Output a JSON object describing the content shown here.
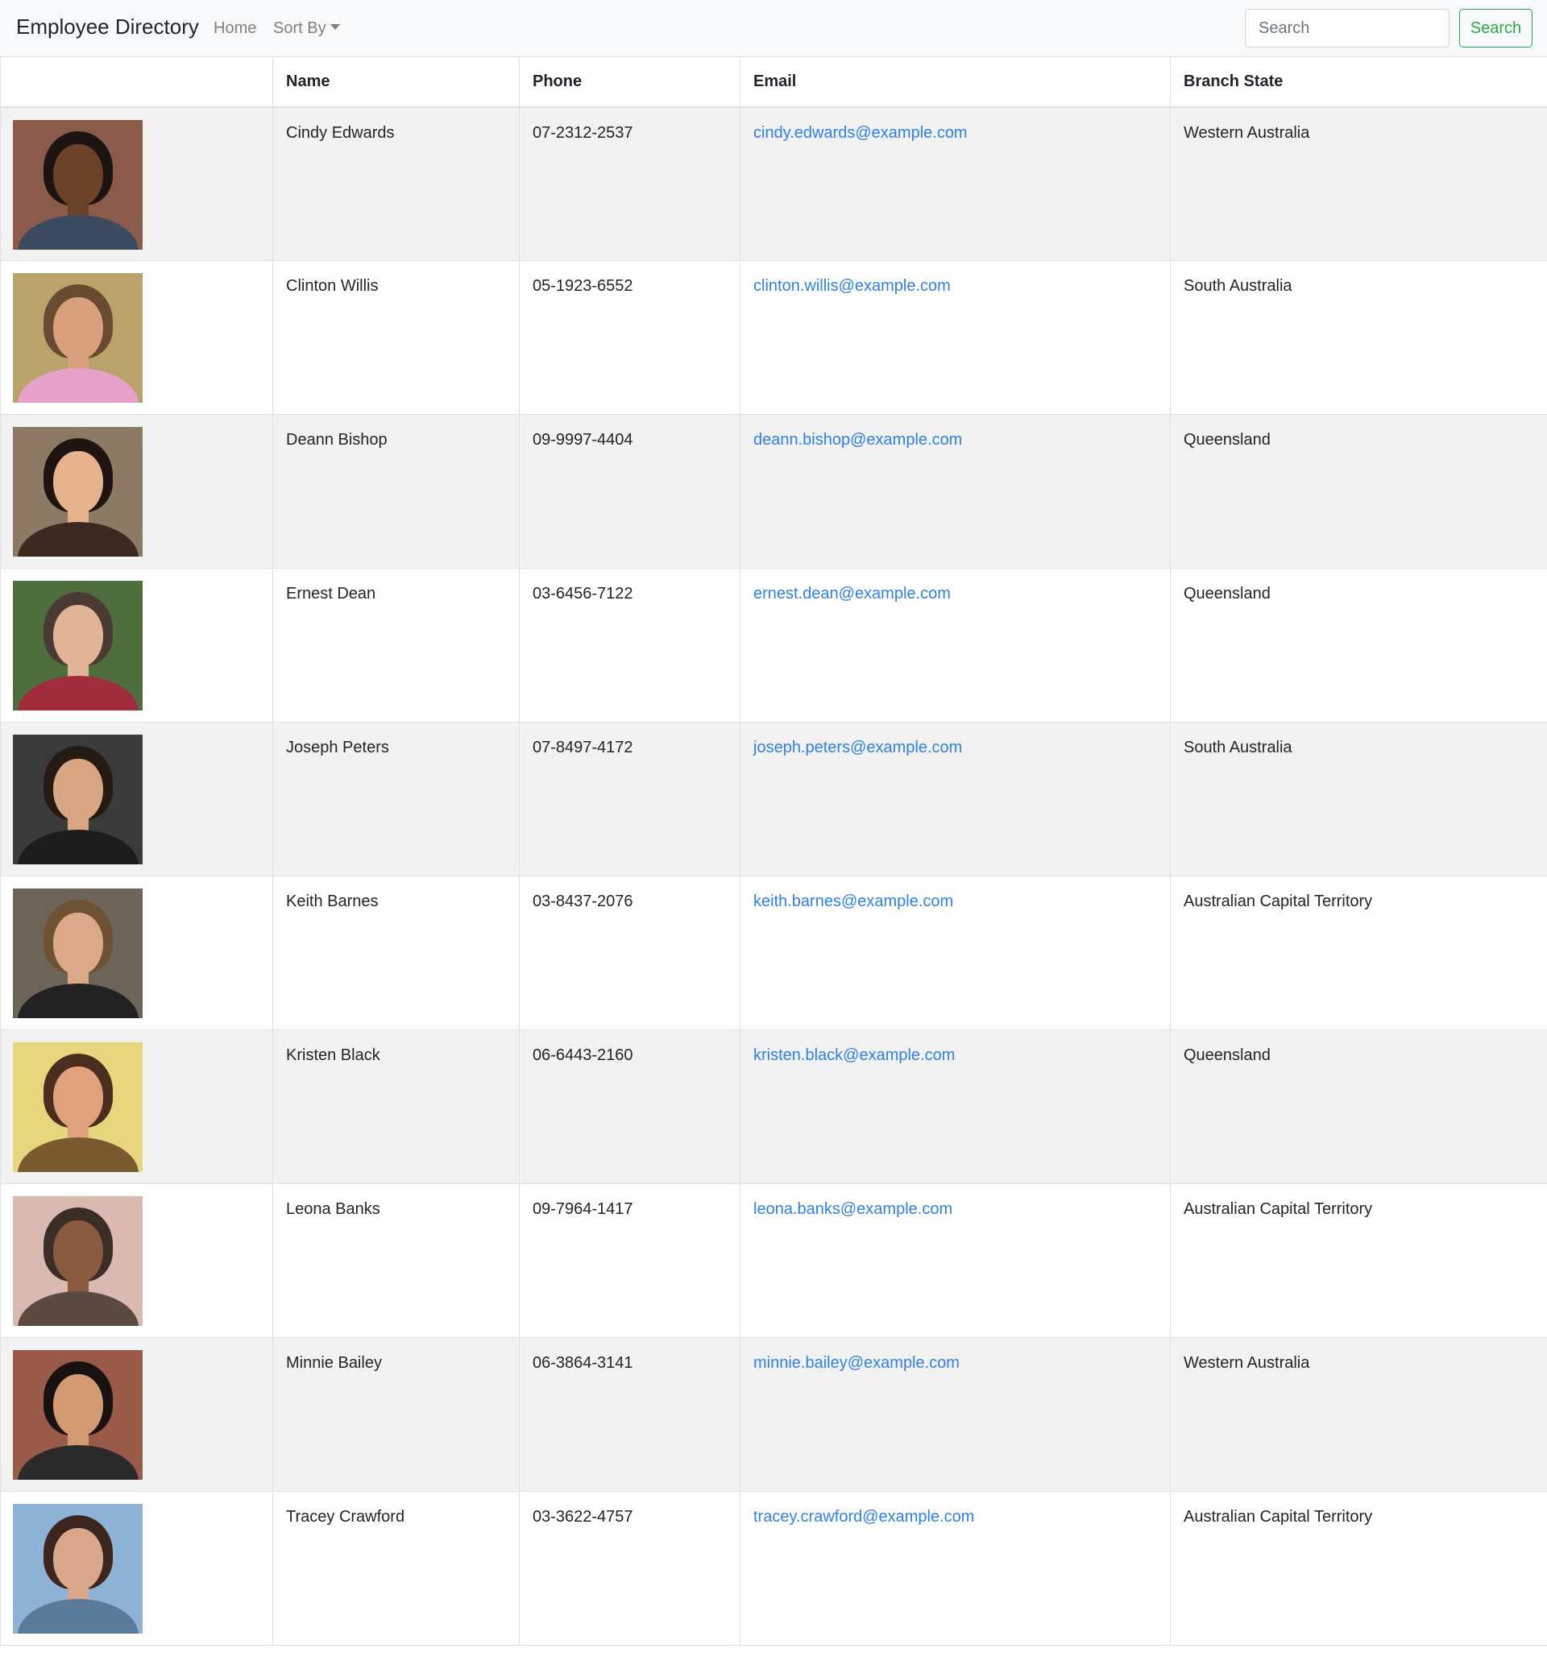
{
  "navbar": {
    "brand": "Employee Directory",
    "home_label": "Home",
    "sort_label": "Sort By",
    "search_placeholder": "Search",
    "search_button_label": "Search",
    "accent_color": "#28a745"
  },
  "table": {
    "headers": {
      "image": "",
      "name": "Name",
      "phone": "Phone",
      "email": "Email",
      "state": "Branch State"
    },
    "link_color": "#2f80ed",
    "rows": [
      {
        "name": "Cindy Edwards",
        "phone": "07-2312-2537",
        "email": "cindy.edwards@example.com",
        "state": "Western Australia",
        "avatar": {
          "bg": "#8a5a4a",
          "hair": "#1c1410",
          "skin": "#6b4228",
          "shirt": "#3b4a5e"
        }
      },
      {
        "name": "Clinton Willis",
        "phone": "05-1923-6552",
        "email": "clinton.willis@example.com",
        "state": "South Australia",
        "avatar": {
          "bg": "#b9a36a",
          "hair": "#6b4a32",
          "skin": "#d9a07e",
          "shirt": "#e6a2c8"
        }
      },
      {
        "name": "Deann Bishop",
        "phone": "09-9997-4404",
        "email": "deann.bishop@example.com",
        "state": "Queensland",
        "avatar": {
          "bg": "#8c7a64",
          "hair": "#1e1510",
          "skin": "#e6b28c",
          "shirt": "#3a2a22"
        }
      },
      {
        "name": "Ernest Dean",
        "phone": "03-6456-7122",
        "email": "ernest.dean@example.com",
        "state": "Queensland",
        "avatar": {
          "bg": "#4f6e3e",
          "hair": "#4a3c34",
          "skin": "#e2b496",
          "shirt": "#a02c3e"
        }
      },
      {
        "name": "Joseph Peters",
        "phone": "07-8497-4172",
        "email": "joseph.peters@example.com",
        "state": "South Australia",
        "avatar": {
          "bg": "#3a3a3a",
          "hair": "#231a14",
          "skin": "#d9a684",
          "shirt": "#1c1c1c"
        }
      },
      {
        "name": "Keith Barnes",
        "phone": "03-8437-2076",
        "email": "keith.barnes@example.com",
        "state": "Australian Capital Territory",
        "avatar": {
          "bg": "#6d6458",
          "hair": "#6e5234",
          "skin": "#dba888",
          "shirt": "#222222"
        }
      },
      {
        "name": "Kristen Black",
        "phone": "06-6443-2160",
        "email": "kristen.black@example.com",
        "state": "Queensland",
        "avatar": {
          "bg": "#e6d77e",
          "hair": "#4a2e1e",
          "skin": "#e0a27c",
          "shirt": "#7a5a2e"
        }
      },
      {
        "name": "Leona Banks",
        "phone": "09-7964-1417",
        "email": "leona.banks@example.com",
        "state": "Australian Capital Territory",
        "avatar": {
          "bg": "#d9b9b0",
          "hair": "#3a2e26",
          "skin": "#8a5a3e",
          "shirt": "#5a4a40"
        }
      },
      {
        "name": "Minnie Bailey",
        "phone": "06-3864-3141",
        "email": "minnie.bailey@example.com",
        "state": "Western Australia",
        "avatar": {
          "bg": "#9a5a4a",
          "hair": "#1a1210",
          "skin": "#d49a74",
          "shirt": "#2a2a2a"
        }
      },
      {
        "name": "Tracey Crawford",
        "phone": "03-3622-4757",
        "email": "tracey.crawford@example.com",
        "state": "Australian Capital Territory",
        "avatar": {
          "bg": "#8fb3d6",
          "hair": "#3e2620",
          "skin": "#d9a88c",
          "shirt": "#5a7a9a"
        }
      }
    ]
  }
}
